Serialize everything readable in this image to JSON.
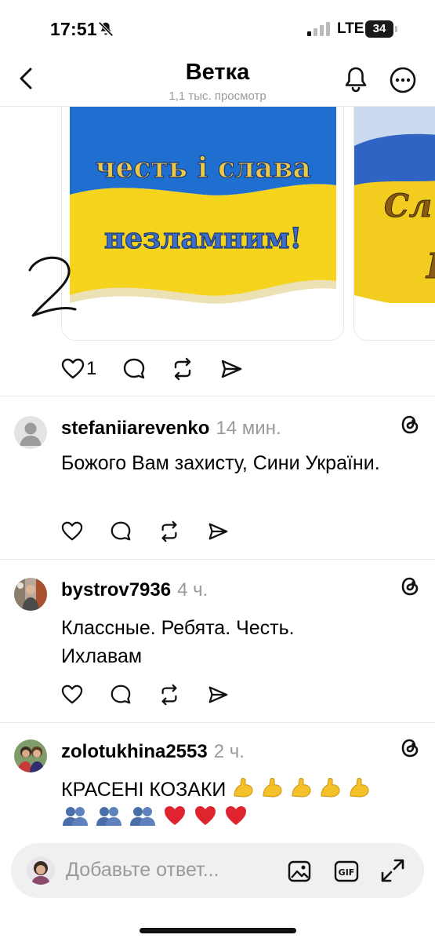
{
  "status_bar": {
    "time": "17:51",
    "network": "LTE",
    "battery": "34"
  },
  "header": {
    "title": "Ветка",
    "subtitle": "1,1 тыс. просмотр"
  },
  "post": {
    "images": [
      {
        "text_line_1": "честь і слава",
        "text_line_2": "незламним!"
      },
      {
        "partial_text": "Сл",
        "partial_text_2": "Г"
      }
    ],
    "handwritten_number": "2",
    "like_count": "1"
  },
  "comments": [
    {
      "username": "stefaniiarevenko",
      "time": "14 мин.",
      "text": "Божого Вам захисту, Сини України."
    },
    {
      "username": "bystrov7936",
      "time": "4 ч.",
      "text": "Классные. Ребята. Честь. Ихлавам"
    },
    {
      "username": "zolotukhina2553",
      "time": "2 ч.",
      "text": "КРАСЕНІ КОЗАКИ"
    }
  ],
  "reply_bar": {
    "placeholder": "Добавьте ответ..."
  },
  "colors": {
    "flag_blue": "#1f6fd0",
    "flag_yellow": "#f6d31c",
    "text_blue": "#1d3a78",
    "heart_red": "#e0242f",
    "emoji_yellow": "#f5c12a",
    "emoji_blue": "#4a6ea8"
  }
}
